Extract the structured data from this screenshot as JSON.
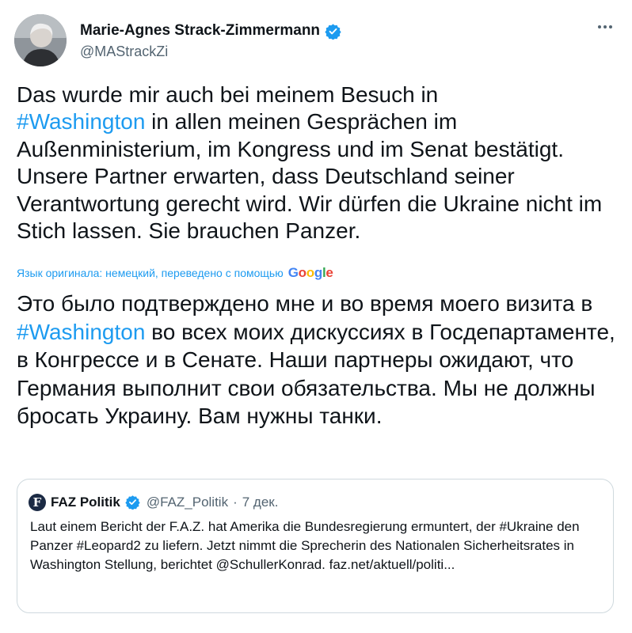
{
  "author": {
    "name": "Marie-Agnes Strack-Zimmermann",
    "handle": "@MAStrackZi",
    "verified_icon": "verified-badge-icon"
  },
  "more_icon": "more-options-icon",
  "tweet": {
    "part1": "Das wurde mir auch bei meinem Besuch in",
    "hashtag": "#Washington",
    "part2": " in allen meinen Gesprächen im Außenministerium, im Kongress und im Senat bestätigt. Unsere Partner erwarten, dass Deutschland seiner Verantwortung gerecht wird. Wir dürfen die Ukraine nicht im Stich lassen. Sie brauchen Panzer."
  },
  "translation": {
    "note": "Язык оригинала: немецкий, переведено с помощью",
    "provider": "Google",
    "part1": "Это было подтверждено мне и во время моего визита в ",
    "hashtag": "#Washington",
    "part2": " во всех моих дискуссиях в Госдепартаменте, в Конгрессе и в Сенате. Наши партнеры ожидают, что Германия выполнит свои обязательства. Мы не должны бросать Украину. Вам нужны танки."
  },
  "quote": {
    "logo_letter": "F",
    "name": "FAZ Politik",
    "handle": "@FAZ_Politik",
    "separator": "·",
    "date": "7 дек.",
    "text": "Laut einem Bericht der F.A.Z. hat Amerika die Bundesregierung ermuntert, der #Ukraine den Panzer #Leopard2 zu liefern. Jetzt nimmt die Sprecherin des Nationalen Sicherheitsrates in Washington Stellung, berichtet @SchullerKonrad. faz.net/aktuell/politi..."
  },
  "colors": {
    "link": "#1d9bf0",
    "text": "#0f1419",
    "secondary": "#536471",
    "border": "#cfd9de"
  }
}
